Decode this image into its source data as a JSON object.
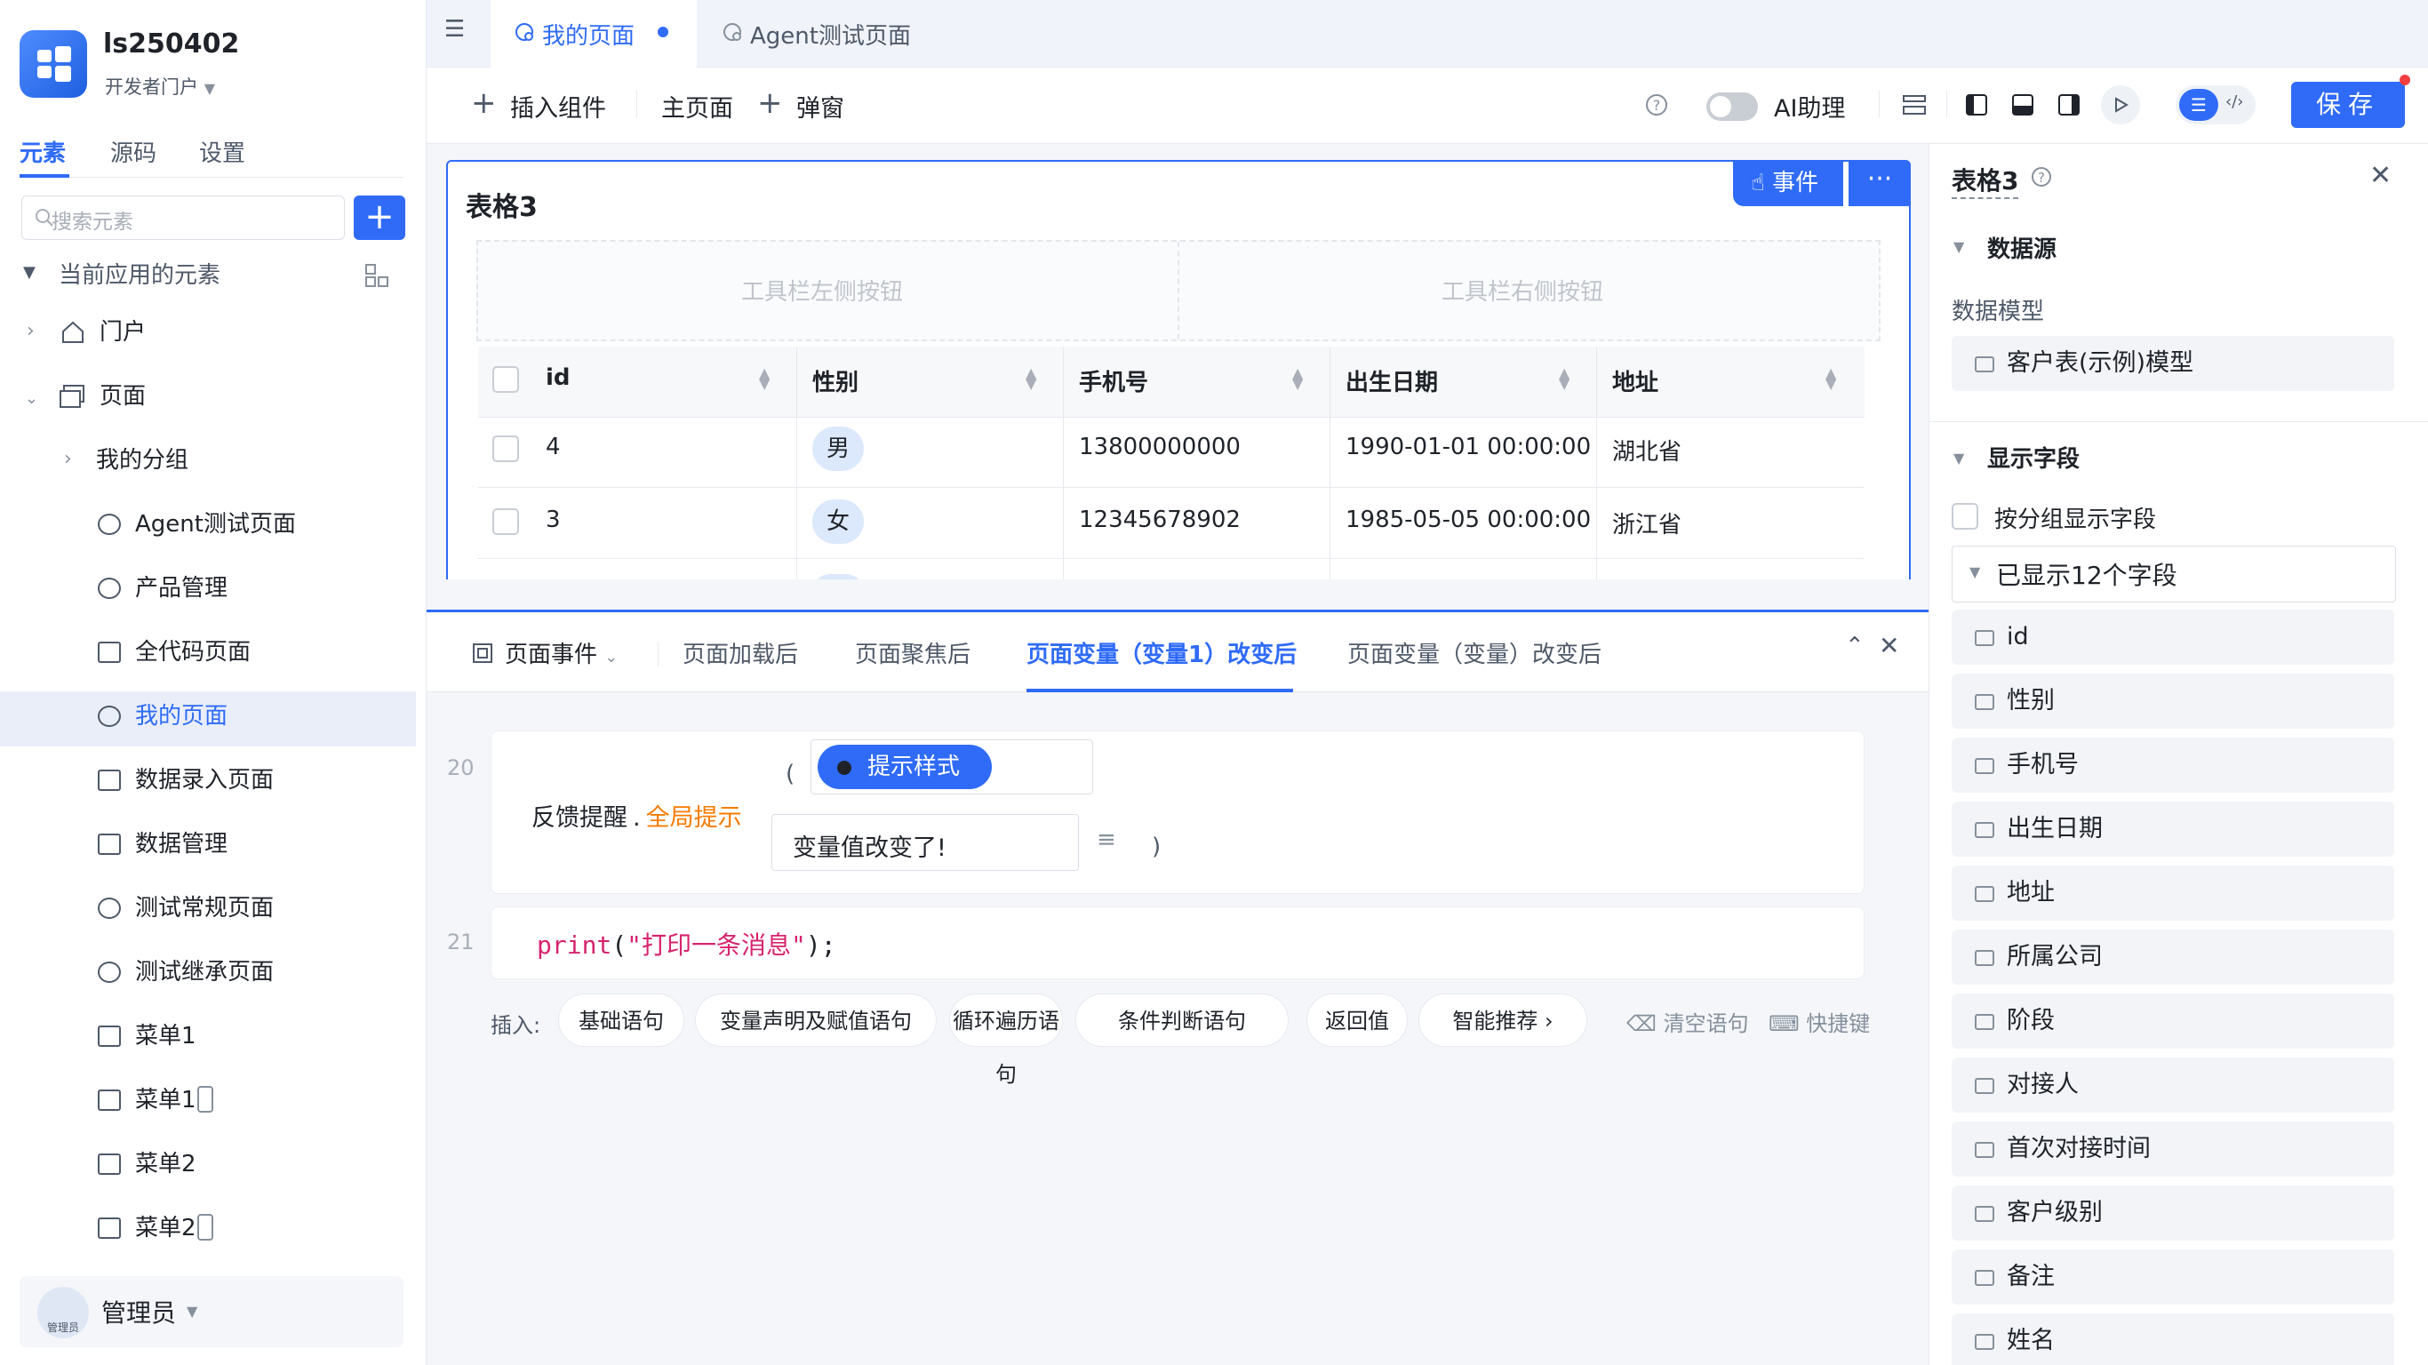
{
  "app": {
    "name": "ls250402",
    "portal": "开发者门户"
  },
  "left_tabs": [
    "元素",
    "源码",
    "设置"
  ],
  "search": {
    "placeholder": "搜索元素"
  },
  "tree": {
    "section": "当前应用的元素",
    "portal": "门户",
    "pages": "页面",
    "group": "我的分组",
    "items": [
      "Agent测试页面",
      "产品管理",
      "全代码页面",
      "我的页面",
      "数据录入页面",
      "数据管理",
      "测试常规页面",
      "测试继承页面",
      "菜单1",
      "菜单1",
      "菜单2",
      "菜单2"
    ]
  },
  "user": {
    "name": "管理员",
    "avatar_text": "管理员"
  },
  "tabs": [
    {
      "label": "我的页面"
    },
    {
      "label": "Agent测试页面"
    }
  ],
  "toolbar": {
    "insert": "插入组件",
    "main": "主页面",
    "popup": "弹窗",
    "ai": "AI助理",
    "save": "保存"
  },
  "table": {
    "title": "表格3",
    "event_btn": "事件",
    "left_btn_ph": "工具栏左侧按钮",
    "right_btn_ph": "工具栏右侧按钮",
    "columns": [
      "id",
      "性别",
      "手机号",
      "出生日期",
      "地址"
    ],
    "rows": [
      {
        "id": "4",
        "gender": "男",
        "phone": "13800000000",
        "birth": "1990-01-01 00:00:00",
        "addr": "湖北省"
      },
      {
        "id": "3",
        "gender": "女",
        "phone": "12345678902",
        "birth": "1985-05-05 00:00:00",
        "addr": "浙江省"
      }
    ]
  },
  "bottom": {
    "event_select": "页面事件",
    "tabs": [
      "页面加载后",
      "页面聚焦后",
      "页面变量（变量1）改变后",
      "页面变量（变量）改变后"
    ],
    "line20": {
      "no": "20",
      "fn": "反馈提醒",
      "dot": ".",
      "method": "全局提示",
      "open": "(",
      "style_tag": "提示样式",
      "message": "变量值改变了!",
      "close": ")"
    },
    "line21": {
      "no": "21",
      "code_fn": "print",
      "code_arg": "\"打印一条消息\"",
      "code_end": ");",
      "code_open": "("
    },
    "insert_label": "插入:",
    "chips": [
      "基础语句",
      "变量声明及赋值语句",
      "循环遍历语句",
      "条件判断语句",
      "返回值",
      "智能推荐 ›"
    ],
    "clear": "清空语句",
    "shortcut": "快捷键"
  },
  "right": {
    "title": "表格3",
    "datasource": "数据源",
    "model_label": "数据模型",
    "model": "客户表(示例)模型",
    "display_fields": "显示字段",
    "group_check": "按分组显示字段",
    "shown": "已显示12个字段",
    "fields": [
      "id",
      "性别",
      "手机号",
      "出生日期",
      "地址",
      "所属公司",
      "阶段",
      "对接人",
      "首次对接时间",
      "客户级别",
      "备注",
      "姓名"
    ]
  },
  "colors": {
    "accent": "#2f6bf7",
    "orange": "#f77b00",
    "pink": "#d6246e"
  }
}
